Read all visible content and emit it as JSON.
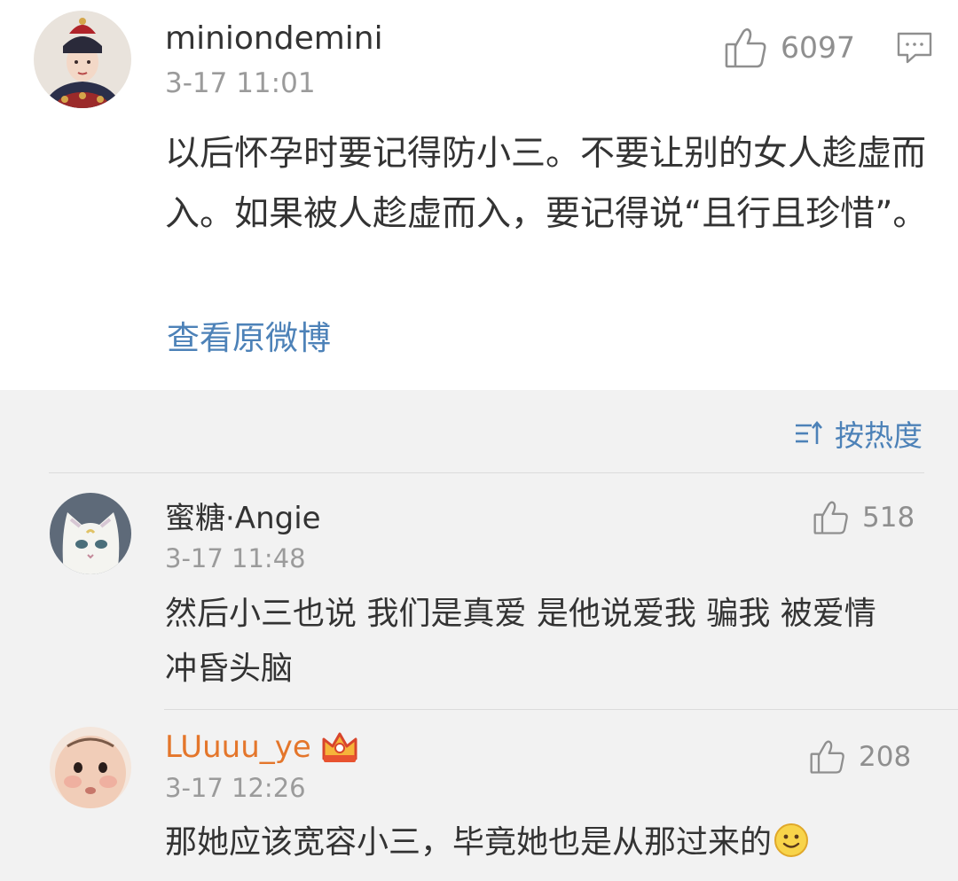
{
  "post": {
    "author": "miniondemini",
    "time": "3-17 11:01",
    "likes": "6097",
    "text": "以后怀孕时要记得防小三。不要让别的女人趁虚而入。如果被人趁虚而入，要记得说“且行且珍惜”。",
    "view_original": "查看原微博"
  },
  "sort": {
    "label": "按热度"
  },
  "comments": [
    {
      "author": "蜜糖·Angie",
      "time": "3-17 11:48",
      "likes": "518",
      "text": "然后小三也说 我们是真爱 是他说爱我 骗我 被爱情冲昏头脑"
    },
    {
      "author": "LUuuu_ye",
      "time": "3-17 12:26",
      "likes": "208",
      "text": "那她应该宽容小三，毕竟她也是从那过来的"
    }
  ],
  "colors": {
    "link": "#4d82b8",
    "vip_name": "#e4762b",
    "meta": "#9b9b9b",
    "text": "#333333",
    "bg_comments": "#f2f2f2"
  },
  "icons": [
    "thumbs-up-icon",
    "comment-icon",
    "sort-icon",
    "crown-icon",
    "smiley-icon"
  ]
}
